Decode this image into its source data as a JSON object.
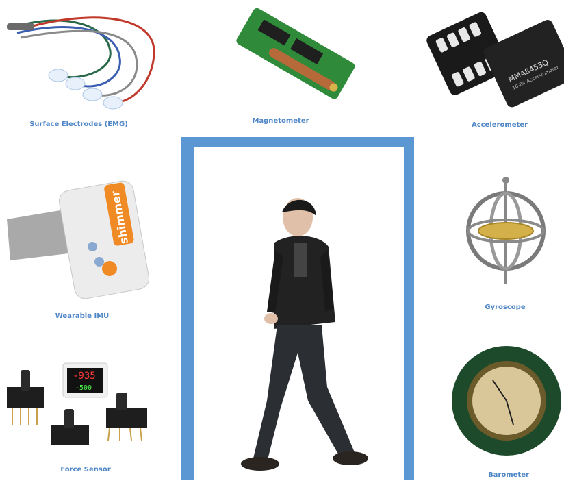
{
  "labels": {
    "emg": "Surface Electrodes (EMG)",
    "magnetometer": "Magnetometer",
    "accelerometer": "Accelerometer",
    "imu": "Wearable IMU",
    "gyroscope": "Gyroscope",
    "force": "Force Sensor",
    "barometer": "Barometer"
  },
  "images": {
    "imu_brand": "shimmer",
    "chip_text_1": "MMA8453Q",
    "chip_text_2": "10-Bit Accelerometer",
    "force_display_top": "-935",
    "force_display_bottom": "-500"
  },
  "colors": {
    "label": "#4f86c6",
    "doorway": "#5b97d2",
    "imu_orange": "#f08a24"
  }
}
